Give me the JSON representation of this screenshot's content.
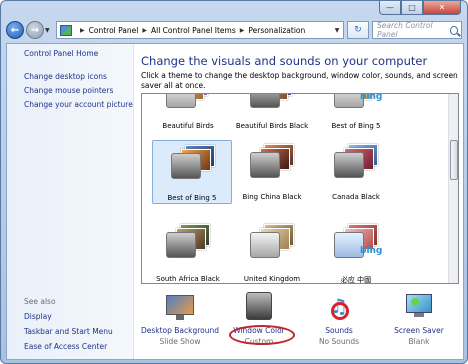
{
  "window": {
    "minimize": "—",
    "maximize": "□",
    "close": "✕"
  },
  "address": {
    "root": "Control Panel",
    "mid": "All Control Panel Items",
    "leaf": "Personalization"
  },
  "search": {
    "placeholder": "Search Control Panel"
  },
  "left": {
    "home": "Control Panel Home",
    "links": [
      "Change desktop icons",
      "Change mouse pointers",
      "Change your account picture"
    ],
    "see_also": "See also",
    "see_links": [
      "Display",
      "Taskbar and Start Menu",
      "Ease of Access Center"
    ]
  },
  "main": {
    "heading": "Change the visuals and sounds on your computer",
    "description": "Click a theme to change the desktop background, window color, sounds, and screen saver all at once."
  },
  "themes": [
    {
      "label": "Beautiful Birds"
    },
    {
      "label": "Beautiful Birds Black"
    },
    {
      "label": "Best of Bing 5",
      "bing": "bing"
    },
    {
      "label": "Best of Bing 5",
      "selected": true
    },
    {
      "label": "Bing China Black"
    },
    {
      "label": "Canada Black"
    },
    {
      "label": "South Africa Black"
    },
    {
      "label": "United Kingdom"
    },
    {
      "label": "必应 中國",
      "bing": "bing"
    }
  ],
  "tools": [
    {
      "label": "Desktop Background",
      "sub": "Slide Show",
      "icon": "desktop-background-icon"
    },
    {
      "label": "Window Color",
      "sub": "Custom",
      "icon": "window-color-icon"
    },
    {
      "label": "Sounds",
      "sub": "No Sounds",
      "icon": "sounds-icon"
    },
    {
      "label": "Screen Saver",
      "sub": "Blank",
      "icon": "screen-saver-icon"
    }
  ],
  "colors": {
    "link": "#1e3287",
    "highlight": "#c0262d"
  }
}
